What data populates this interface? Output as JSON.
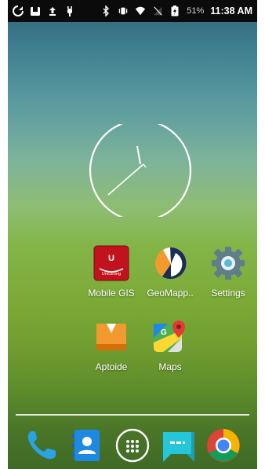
{
  "status_bar": {
    "battery_percent": "51%",
    "time": "11:38 AM"
  },
  "apps": [
    {
      "label": "Mobile GIS",
      "icon": "mobile-gis-icon",
      "badge_text": "U",
      "badge_subtext": "UniStrong"
    },
    {
      "label": "GeoMapp..",
      "icon": "geomapper-icon"
    },
    {
      "label": "Settings",
      "icon": "gear-icon"
    },
    {
      "label": "Aptoide",
      "icon": "aptoide-icon"
    },
    {
      "label": "Maps",
      "icon": "maps-icon"
    }
  ],
  "dock": [
    {
      "name": "phone",
      "icon": "phone-icon"
    },
    {
      "name": "contacts",
      "icon": "contacts-icon"
    },
    {
      "name": "app-drawer",
      "icon": "apps-grid-icon"
    },
    {
      "name": "messages",
      "icon": "messages-icon"
    },
    {
      "name": "chrome",
      "icon": "chrome-icon"
    }
  ],
  "colors": {
    "statusbar_bg": "#0b0b0b",
    "wallpaper_top": "#2f5f78",
    "wallpaper_bottom": "#3e6a26"
  }
}
